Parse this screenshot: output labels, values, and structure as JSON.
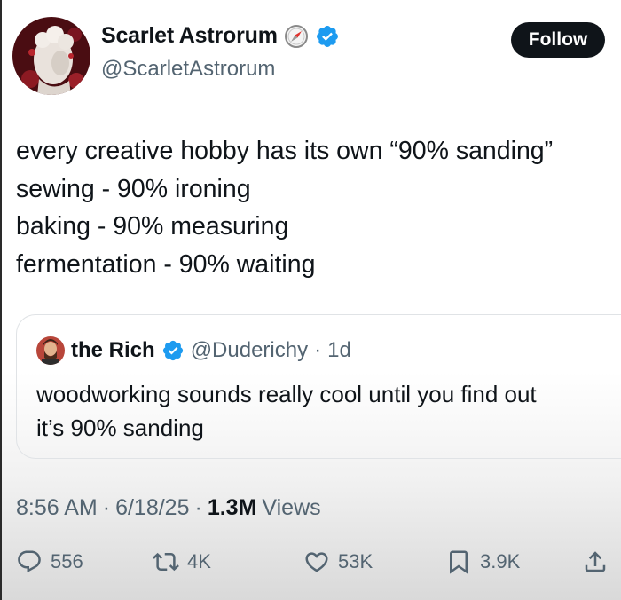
{
  "author": {
    "display_name": "Scarlet Astrorum",
    "handle": "@ScarletAstrorum",
    "follow_label": "Follow"
  },
  "tweet": {
    "lines": [
      "every creative hobby has its own “90% sanding”",
      "sewing - 90% ironing",
      "baking - 90% measuring",
      "fermentation - 90% waiting"
    ]
  },
  "quote": {
    "name": "the Rich",
    "handle": "@Duderichy",
    "separator": "·",
    "age": "1d",
    "lines": [
      "woodworking sounds really cool until you find out",
      "it’s 90% sanding"
    ]
  },
  "meta": {
    "time": "8:56 AM",
    "separator": "·",
    "date": "6/18/25",
    "views_count": "1.3M",
    "views_label": "Views"
  },
  "actions": {
    "replies": "556",
    "reposts": "4K",
    "likes": "53K",
    "bookmarks": "3.9K"
  },
  "colors": {
    "verified": "#1d9bf0",
    "text": "#0f1419",
    "secondary": "#536471"
  }
}
